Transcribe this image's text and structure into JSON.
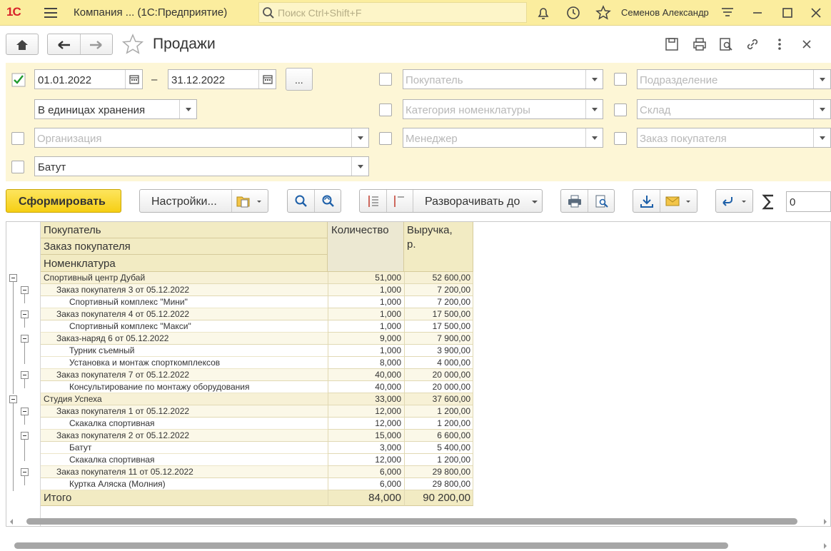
{
  "titlebar": {
    "logo": "1С",
    "app_title": "Компания ...  (1С:Предприятие)",
    "search_placeholder": "Поиск Ctrl+Shift+F",
    "user_name": "Семенов Александр"
  },
  "form": {
    "title": "Продажи"
  },
  "filters": {
    "period": {
      "checked": true,
      "from": "01.01.2022",
      "dash": "–",
      "to": "31.12.2022",
      "more_button": "..."
    },
    "units": "В единицах хранения",
    "organization": {
      "checked": false,
      "placeholder": "Организация"
    },
    "product": {
      "checked": false,
      "value": "Батут"
    },
    "buyer": {
      "checked": false,
      "placeholder": "Покупатель"
    },
    "category": {
      "checked": false,
      "placeholder": "Категория номенклатуры"
    },
    "manager": {
      "checked": false,
      "placeholder": "Менеджер"
    },
    "division": {
      "checked": false,
      "placeholder": "Подразделение"
    },
    "warehouse": {
      "checked": false,
      "placeholder": "Склад"
    },
    "order": {
      "checked": false,
      "placeholder": "Заказ покупателя"
    }
  },
  "toolbar": {
    "generate": "Сформировать",
    "settings": "Настройки...",
    "expand_to": "Разворачивать до",
    "sum_value": "0"
  },
  "report": {
    "headers": {
      "group1": "Покупатель",
      "group2": "Заказ покупателя",
      "group3": "Номенклатура",
      "qty": "Количество",
      "revenue": "Выручка,",
      "revenue_unit": "р."
    },
    "rows": [
      {
        "level": 0,
        "name": "Спортивный центр Дубай",
        "qty": "51,000",
        "revenue": "52 600,00"
      },
      {
        "level": 1,
        "name": "Заказ покупателя 3 от 05.12.2022",
        "qty": "1,000",
        "revenue": "7 200,00"
      },
      {
        "level": 2,
        "name": "Спортивный комплекс \"Мини\"",
        "qty": "1,000",
        "revenue": "7 200,00"
      },
      {
        "level": 1,
        "name": "Заказ покупателя 4 от 05.12.2022",
        "qty": "1,000",
        "revenue": "17 500,00"
      },
      {
        "level": 2,
        "name": "Спортивный комплекс \"Макси\"",
        "qty": "1,000",
        "revenue": "17 500,00"
      },
      {
        "level": 1,
        "name": "Заказ-наряд 6 от 05.12.2022",
        "qty": "9,000",
        "revenue": "7 900,00"
      },
      {
        "level": 2,
        "name": "Турник съемный",
        "qty": "1,000",
        "revenue": "3 900,00"
      },
      {
        "level": 2,
        "name": "Установка и монтаж спорткомплексов",
        "qty": "8,000",
        "revenue": "4 000,00"
      },
      {
        "level": 1,
        "name": "Заказ покупателя 7 от 05.12.2022",
        "qty": "40,000",
        "revenue": "20 000,00"
      },
      {
        "level": 2,
        "name": "Консультирование по монтажу оборудования",
        "qty": "40,000",
        "revenue": "20 000,00"
      },
      {
        "level": 0,
        "name": "Студия Успеха",
        "qty": "33,000",
        "revenue": "37 600,00"
      },
      {
        "level": 1,
        "name": "Заказ покупателя 1 от 05.12.2022",
        "qty": "12,000",
        "revenue": "1 200,00"
      },
      {
        "level": 2,
        "name": "Скакалка спортивная",
        "qty": "12,000",
        "revenue": "1 200,00"
      },
      {
        "level": 1,
        "name": "Заказ покупателя 2 от 05.12.2022",
        "qty": "15,000",
        "revenue": "6 600,00"
      },
      {
        "level": 2,
        "name": "Батут",
        "qty": "3,000",
        "revenue": "5 400,00"
      },
      {
        "level": 2,
        "name": "Скакалка спортивная",
        "qty": "12,000",
        "revenue": "1 200,00"
      },
      {
        "level": 1,
        "name": "Заказ покупателя 11 от 05.12.2022",
        "qty": "6,000",
        "revenue": "29 800,00"
      },
      {
        "level": 2,
        "name": "Куртка Аляска (Молния)",
        "qty": "6,000",
        "revenue": "29 800,00"
      }
    ],
    "total": {
      "name": "Итого",
      "qty": "84,000",
      "revenue": "90 200,00"
    }
  },
  "colors": {
    "title_bar": "#fbed9e",
    "filter_panel": "#fdf6d6",
    "generate_button": "#f6cf14",
    "report_header": "#f2ebc3",
    "logo": "#d8232a"
  }
}
